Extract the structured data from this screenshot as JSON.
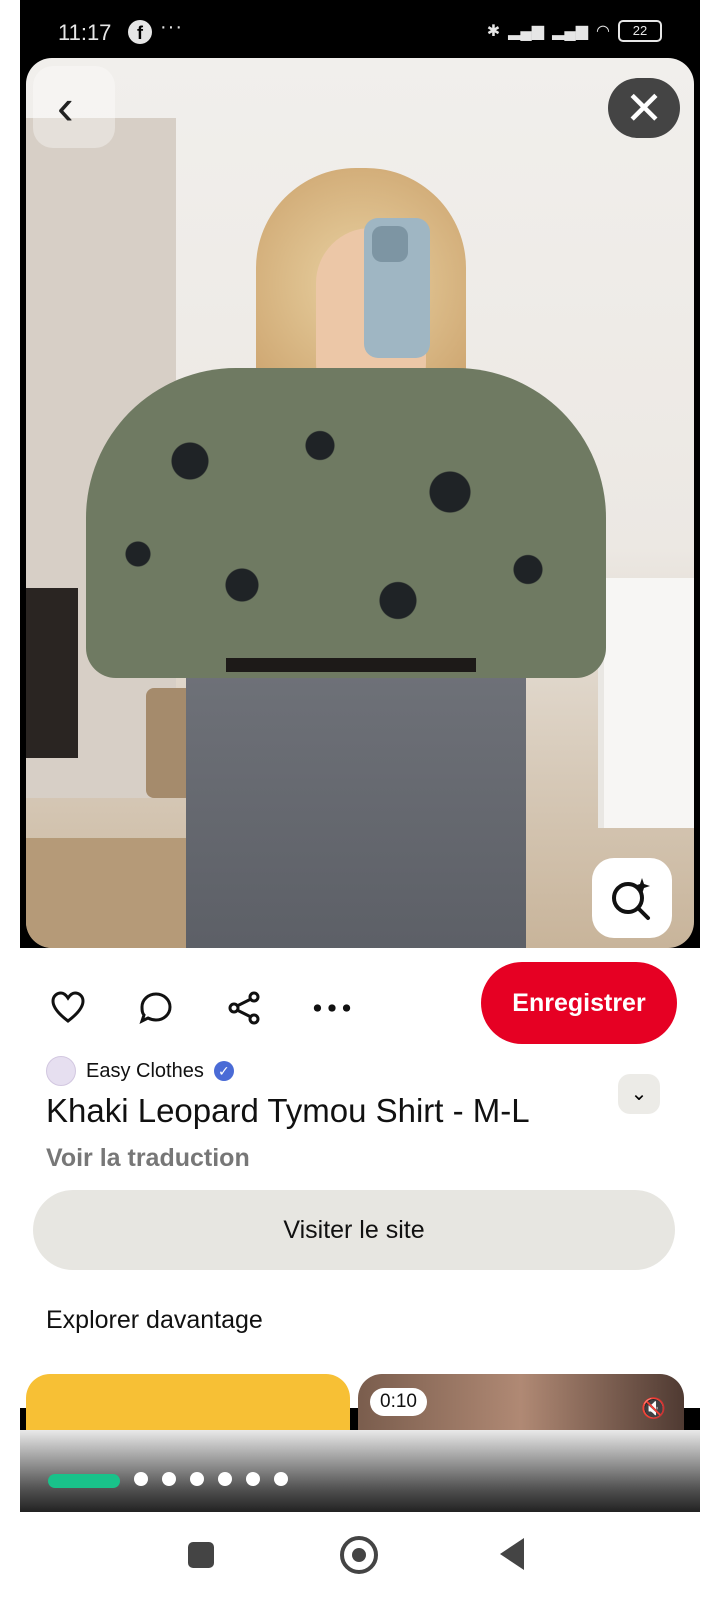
{
  "status_bar": {
    "time": "11:17",
    "more": "···",
    "battery": "22"
  },
  "pin": {
    "creator": "Easy Clothes",
    "title": "Khaki Leopard Tymou Shirt - M-L",
    "translate_label": "Voir la traduction",
    "save_label": "Enregistrer",
    "visit_label": "Visiter le site",
    "explore_label": "Explorer davantage"
  },
  "more_feed": {
    "video_duration": "0:10"
  },
  "icons": {
    "back": "chevron-left-icon",
    "close": "close-icon",
    "lens": "visual-search-icon",
    "like": "heart-icon",
    "comment": "comment-icon",
    "share": "share-icon",
    "more": "more-icon",
    "expand": "chevron-down-icon",
    "mute": "mute-icon"
  },
  "colors": {
    "save_button": "#e60023",
    "progress": "#19c28a"
  }
}
